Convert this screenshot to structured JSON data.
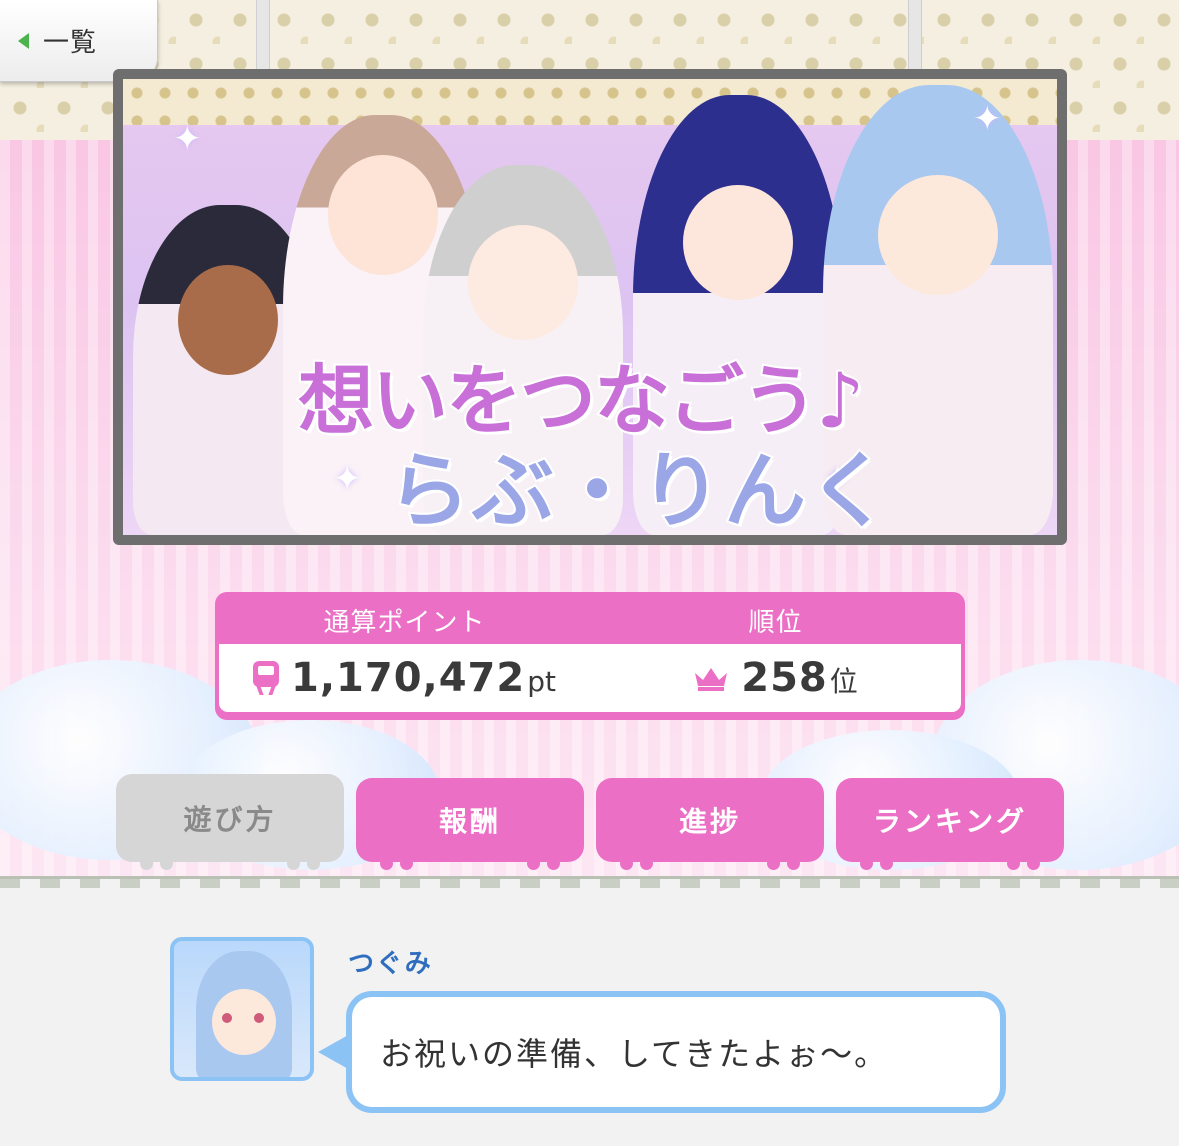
{
  "header": {
    "back_label": "一覧"
  },
  "banner": {
    "logo_line1": "想いをつなごう♪",
    "logo_line2": "らぶ・りんく"
  },
  "score": {
    "points_label": "通算ポイント",
    "rank_label": "順位",
    "points_value": "1,170,472",
    "points_unit": "pt",
    "rank_value": "258",
    "rank_unit": "位"
  },
  "tabs": [
    {
      "label": "遊び方",
      "state": "disabled"
    },
    {
      "label": "報酬",
      "state": "active"
    },
    {
      "label": "進捗",
      "state": "active"
    },
    {
      "label": "ランキング",
      "state": "active"
    }
  ],
  "dialog": {
    "speaker": "つぐみ",
    "message": "お祝いの準備、してきたよぉ〜。"
  },
  "colors": {
    "accent_pink": "#ec6fc6",
    "bubble_blue": "#8cc3f5",
    "back_arrow_green": "#4bb34b",
    "speaker_blue": "#2f6dbf"
  },
  "icons": {
    "back": "chevron-left-icon",
    "points": "train-icon",
    "rank": "crown-icon"
  }
}
